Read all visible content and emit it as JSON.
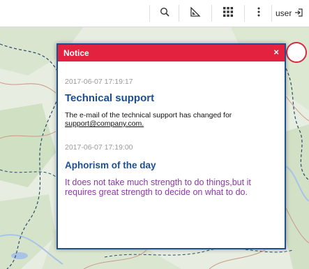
{
  "toolbar": {
    "buttons": [
      {
        "icon": "search-icon"
      },
      {
        "icon": "ruler-icon"
      },
      {
        "icon": "grid-icon"
      },
      {
        "icon": "more-vertical-icon"
      }
    ],
    "user_label": "user",
    "user_icon": "logout-icon"
  },
  "dialog": {
    "title": "Notice",
    "close_glyph": "×",
    "messages": [
      {
        "date": "2017-06-07 17:19:17",
        "title": "Technical support",
        "text": "The e-mail of the technical support has changed for",
        "link": "support@company.com."
      },
      {
        "date": "2017-06-07 17:19:00",
        "title": "Aphorism of the day",
        "text": "It does not take much strength to do things,but it requires great strength to decide on what to do."
      }
    ]
  },
  "colors": {
    "header": "#e3223f",
    "border": "#1e4f8f",
    "title": "#1a4f96",
    "aphorism": "#8a3aa3"
  }
}
